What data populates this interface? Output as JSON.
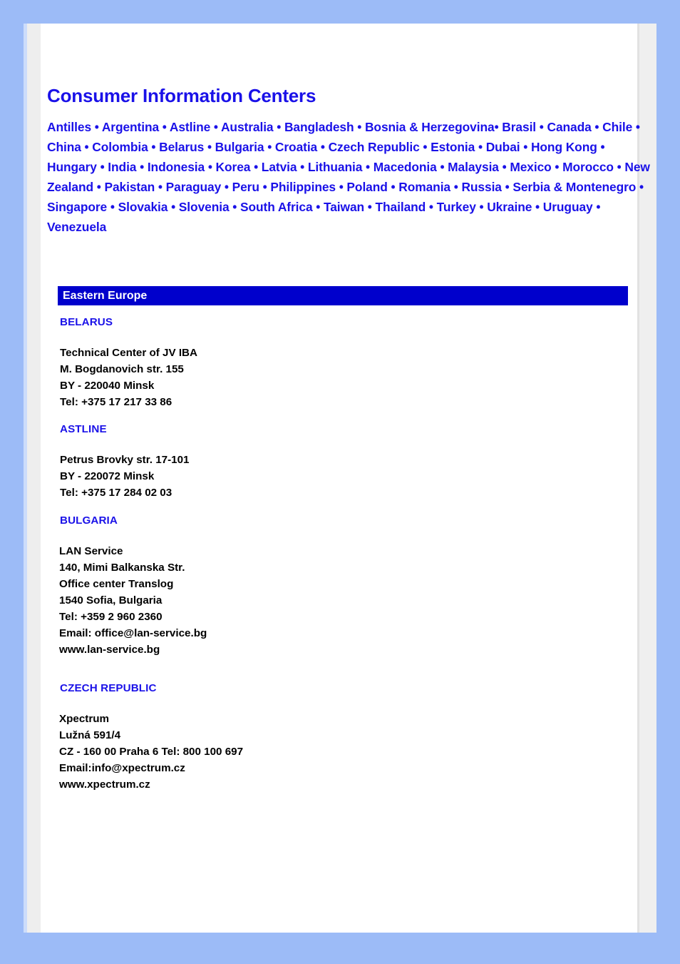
{
  "page": {
    "title": "Consumer Information Centers",
    "background_color": "#9cbbf7",
    "sheet_color": "#ffffff",
    "link_color": "#1a11e8",
    "accent_bar_color": "#0000cc"
  },
  "country_links": [
    "Antilles",
    "Argentina",
    "Astline",
    "Australia",
    "Bangladesh",
    "Bosnia & Herzegovina",
    "Brasil",
    "Canada",
    "Chile",
    "China",
    "Colombia",
    "Belarus",
    "Bulgaria",
    "Croatia",
    "Czech Republic",
    "Estonia",
    "Dubai",
    "Hong Kong",
    "Hungary",
    "India",
    "Indonesia",
    "Korea",
    "Latvia",
    "Lithuania",
    "Macedonia",
    "Malaysia",
    "Mexico",
    "Morocco",
    "New Zealand",
    "Pakistan",
    "Paraguay",
    "Peru",
    "Philippines",
    "Poland",
    "Romania",
    "Russia",
    "Serbia & Montenegro",
    "Singapore",
    "Slovakia",
    "Slovenia",
    "South Africa",
    "Taiwan",
    "Thailand",
    "Turkey",
    "Ukraine",
    "Uruguay",
    "Venezuela"
  ],
  "country_links_text": "Antilles • Argentina • Astline • Australia • Bangladesh • Bosnia & Herzegovina• Brasil • Canada • Chile • China • Colombia • Belarus • Bulgaria • Croatia • Czech Republic • Estonia • Dubai •  Hong Kong • Hungary • India • Indonesia • Korea • Latvia • Lithuania • Macedonia • Malaysia • Mexico • Morocco • New Zealand • Pakistan • Paraguay • Peru • Philippines • Poland • Romania • Russia • Serbia & Montenegro • Singapore • Slovakia • Slovenia • South Africa • Taiwan • Thailand • Turkey • Ukraine • Uruguay • Venezuela",
  "section": {
    "label": "Eastern Europe"
  },
  "entries": [
    {
      "heading": "BELARUS",
      "address": "Technical Center of JV IBA\nM. Bogdanovich str. 155\nBY - 220040 Minsk\nTel: +375 17 217 33 86"
    },
    {
      "heading": "ASTLINE",
      "address": "Petrus Brovky str. 17-101\nBY - 220072 Minsk\nTel: +375 17 284 02 03"
    },
    {
      "heading": "BULGARIA",
      "address": "LAN Service\n140, Mimi Balkanska Str.\nOffice center Translog\n1540 Sofia, Bulgaria\nTel: +359 2 960 2360\nEmail: office@lan-service.bg\nwww.lan-service.bg"
    },
    {
      "heading": "CZECH REPUBLIC",
      "address": "Xpectrum\nLužná 591/4\nCZ - 160 00 Praha 6 Tel: 800 100 697\nEmail:info@xpectrum.cz\nwww.xpectrum.cz"
    }
  ]
}
